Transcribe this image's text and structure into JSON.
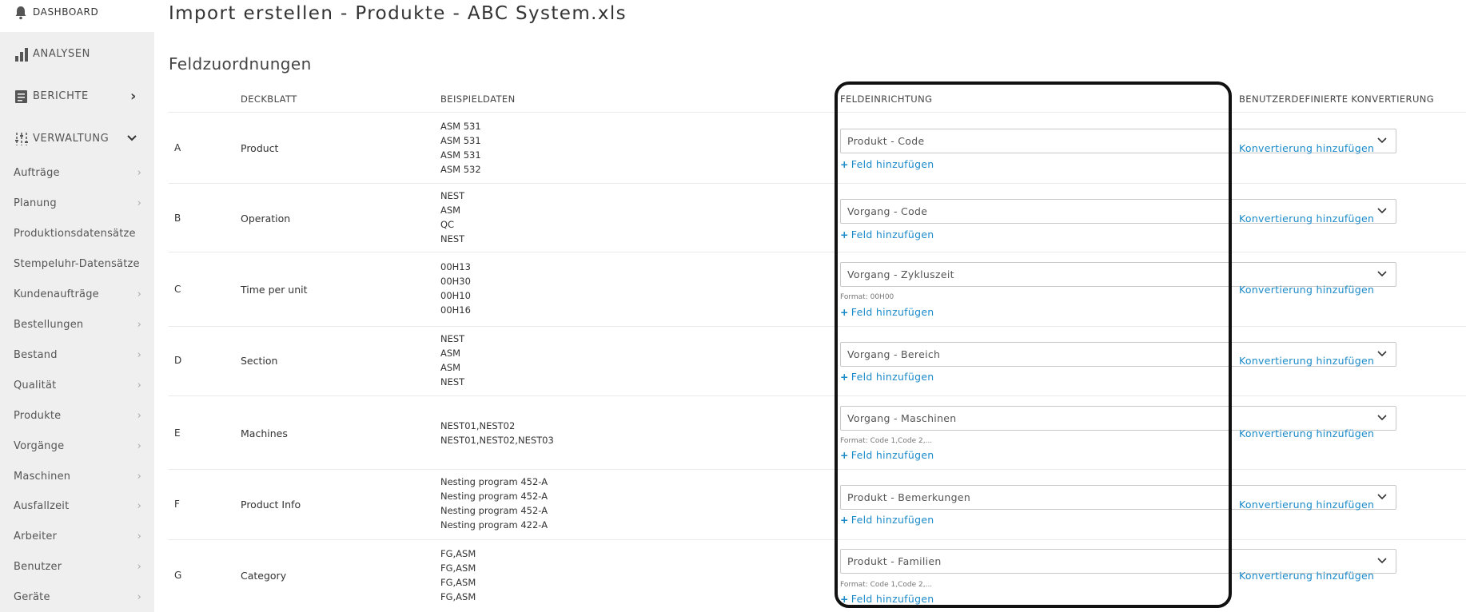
{
  "sidebar": {
    "sections": [
      {
        "label": "DASHBOARD",
        "icon": "bell-icon"
      },
      {
        "label": "ANALYSEN",
        "icon": "bar-chart-icon"
      },
      {
        "label": "BERICHTE",
        "icon": "document-icon",
        "chevron": "›"
      },
      {
        "label": "VERWALTUNG",
        "icon": "sliders-icon",
        "chevron": "⌄"
      }
    ],
    "items": [
      {
        "label": "Aufträge",
        "arrow": "›"
      },
      {
        "label": "Planung",
        "arrow": "›"
      },
      {
        "label": "Produktionsdatensätze",
        "arrow": ""
      },
      {
        "label": "Stempeluhr-Datensätze",
        "arrow": ""
      },
      {
        "label": "Kundenaufträge",
        "arrow": "›"
      },
      {
        "label": "Bestellungen",
        "arrow": "›"
      },
      {
        "label": "Bestand",
        "arrow": "›"
      },
      {
        "label": "Qualität",
        "arrow": "›"
      },
      {
        "label": "Produkte",
        "arrow": "›"
      },
      {
        "label": "Vorgänge",
        "arrow": "›"
      },
      {
        "label": "Maschinen",
        "arrow": "›"
      },
      {
        "label": "Ausfallzeit",
        "arrow": "›"
      },
      {
        "label": "Arbeiter",
        "arrow": "›"
      },
      {
        "label": "Benutzer",
        "arrow": "›"
      },
      {
        "label": "Geräte",
        "arrow": "›"
      }
    ]
  },
  "page": {
    "title": "Import erstellen - Produkte - ABC System.xls",
    "section_title": "Feldzuordnungen"
  },
  "columns": {
    "deckblatt": "DECKBLATT",
    "beispieldaten": "BEISPIELDATEN",
    "feldeinrichtung": "FELDEINRICHTUNG",
    "konvertierung": "BENUTZERDEFINIERTE KONVERTIERUNG"
  },
  "add_field_label": "Feld hinzufügen",
  "add_conversion_label": "Konvertierung hinzufügen",
  "rows": [
    {
      "letter": "A",
      "name": "Product",
      "samples": [
        "ASM 531",
        "ASM 531",
        "ASM 531",
        "ASM 532"
      ],
      "field": "Produkt - Code",
      "format": ""
    },
    {
      "letter": "B",
      "name": "Operation",
      "samples": [
        "NEST",
        "ASM",
        "QC",
        "NEST"
      ],
      "field": "Vorgang - Code",
      "format": ""
    },
    {
      "letter": "C",
      "name": "Time per unit",
      "samples": [
        "00H13",
        "00H30",
        "00H10",
        "00H16"
      ],
      "field": "Vorgang - Zykluszeit",
      "format": "Format: 00H00"
    },
    {
      "letter": "D",
      "name": "Section",
      "samples": [
        "NEST",
        "ASM",
        "ASM",
        "NEST"
      ],
      "field": "Vorgang - Bereich",
      "format": ""
    },
    {
      "letter": "E",
      "name": "Machines",
      "samples": [
        "NEST01,NEST02",
        "NEST01,NEST02,NEST03"
      ],
      "field": "Vorgang - Maschinen",
      "format": "Format: Code 1,Code 2,..."
    },
    {
      "letter": "F",
      "name": "Product Info",
      "samples": [
        "Nesting program 452-A",
        "Nesting program 452-A",
        "Nesting program 452-A",
        "Nesting program 422-A"
      ],
      "field": "Produkt - Bemerkungen",
      "format": ""
    },
    {
      "letter": "G",
      "name": "Category",
      "samples": [
        "FG,ASM",
        "FG,ASM",
        "FG,ASM",
        "FG,ASM"
      ],
      "field": "Produkt - Familien",
      "format": "Format: Code 1,Code 2,..."
    }
  ]
}
